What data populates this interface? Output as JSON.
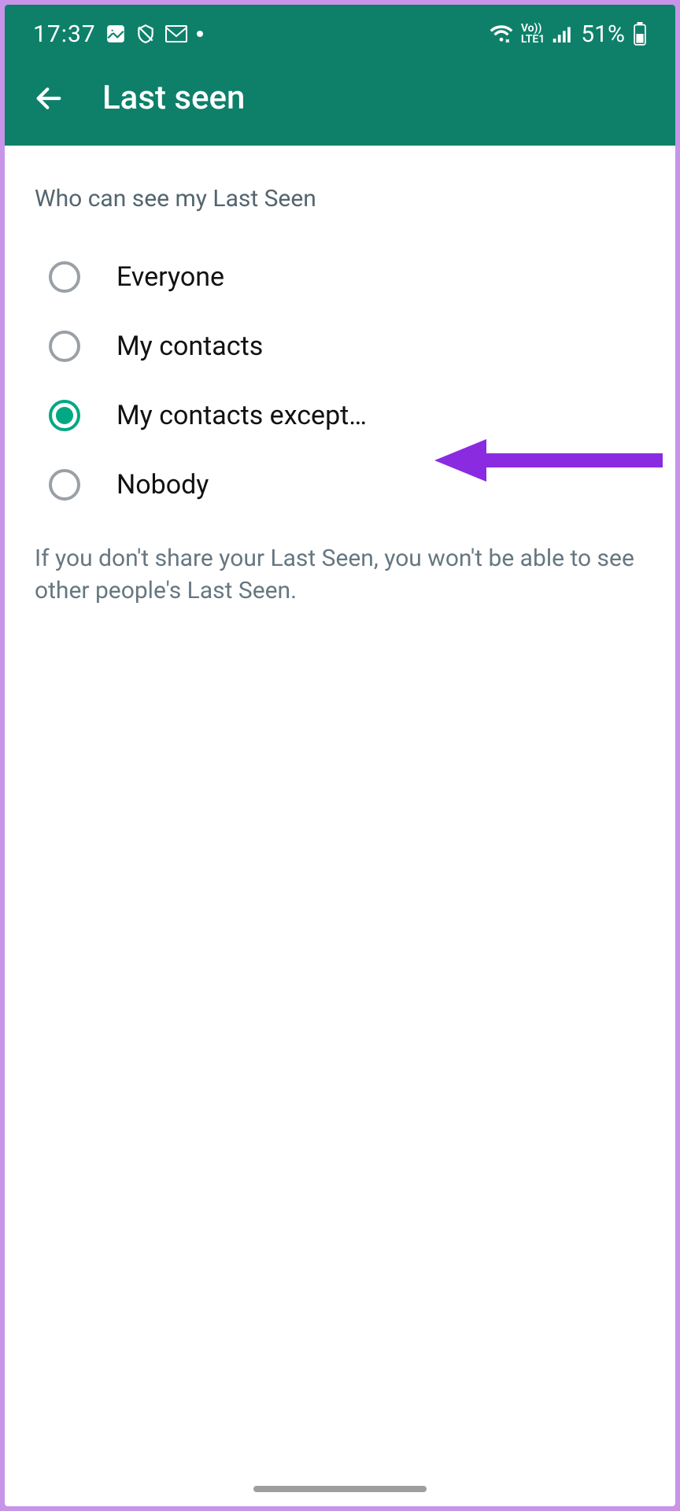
{
  "status": {
    "time": "17:37",
    "volte_top": "Vo))",
    "volte_bottom": "LTE1",
    "battery_pct": "51%"
  },
  "header": {
    "title": "Last seen"
  },
  "section": {
    "title": "Who can see my Last Seen"
  },
  "options": [
    {
      "label": "Everyone",
      "selected": false
    },
    {
      "label": "My contacts",
      "selected": false
    },
    {
      "label": "My contacts except…",
      "selected": true
    },
    {
      "label": "Nobody",
      "selected": false
    }
  ],
  "footer": "If you don't share your Last Seen, you won't be able to see other people's Last Seen.",
  "colors": {
    "accent": "#00a884",
    "header": "#0e806a",
    "annotation": "#8a2be2"
  }
}
